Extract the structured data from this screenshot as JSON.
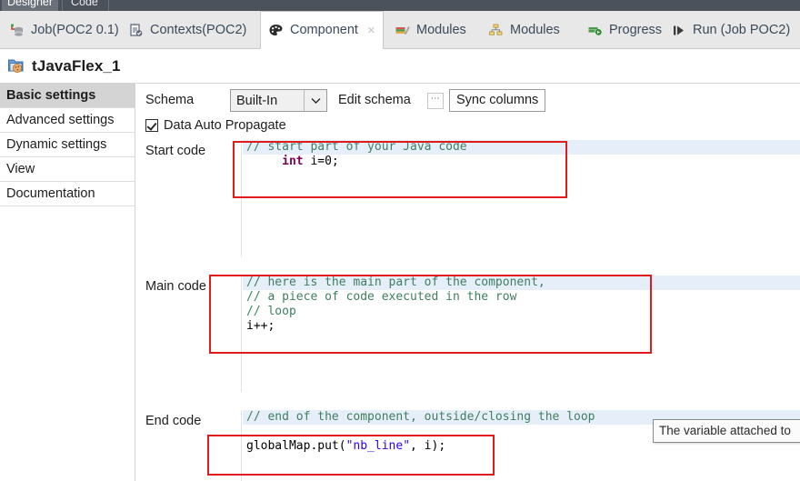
{
  "top_strip": {
    "tabs": [
      {
        "label": "Designer",
        "active": true
      },
      {
        "label": "Code",
        "active": false
      }
    ]
  },
  "tabbar": {
    "tabs": [
      {
        "label": "Job(POC2 0.1)",
        "icon": "job-icon",
        "active": false,
        "closable": false
      },
      {
        "label": "Contexts(POC2)",
        "icon": "contexts-icon",
        "active": false,
        "closable": false
      },
      {
        "label": "Component",
        "icon": "palette-icon",
        "active": true,
        "closable": true,
        "close_label": "×"
      },
      {
        "label": "Modules",
        "icon": "modules-books-icon",
        "active": false,
        "closable": false
      },
      {
        "label": "Modules",
        "icon": "modules-tree-icon",
        "active": false,
        "closable": false
      },
      {
        "label": "Progress",
        "icon": "progress-icon",
        "active": false,
        "closable": false
      },
      {
        "label": "Run (Job POC2)",
        "icon": "run-icon",
        "active": false,
        "closable": false
      }
    ]
  },
  "header": {
    "title": "tJavaFlex_1",
    "icon": "component-cookie-icon"
  },
  "sidebar": {
    "items": [
      {
        "label": "Basic settings",
        "selected": true
      },
      {
        "label": "Advanced settings",
        "selected": false
      },
      {
        "label": "Dynamic settings",
        "selected": false
      },
      {
        "label": "View",
        "selected": false
      },
      {
        "label": "Documentation",
        "selected": false
      }
    ]
  },
  "main": {
    "schema": {
      "label": "Schema",
      "value": "Built-In",
      "dropdown_arrow": "⌄",
      "edit_schema_label": "Edit schema",
      "ellipsis_button": "⋯",
      "sync_columns_label": "Sync columns"
    },
    "data_auto_propagate": {
      "label": "Data Auto Propagate",
      "checked": true
    },
    "start_code": {
      "label": "Start code",
      "lines": [
        {
          "highlight": true,
          "tokens": [
            {
              "t": "comment",
              "s": "// start part of your Java code"
            }
          ]
        },
        {
          "highlight": false,
          "tokens": [
            {
              "t": "plain",
              "s": "     "
            },
            {
              "t": "kw",
              "s": "int"
            },
            {
              "t": "plain",
              "s": " i=0;"
            }
          ]
        },
        {
          "highlight": false,
          "tokens": [
            {
              "t": "plain",
              "s": ""
            }
          ]
        },
        {
          "highlight": false,
          "tokens": [
            {
              "t": "plain",
              "s": ""
            }
          ]
        },
        {
          "highlight": false,
          "tokens": [
            {
              "t": "plain",
              "s": ""
            }
          ]
        },
        {
          "highlight": false,
          "tokens": [
            {
              "t": "plain",
              "s": ""
            }
          ]
        },
        {
          "highlight": false,
          "tokens": [
            {
              "t": "plain",
              "s": ""
            }
          ]
        },
        {
          "highlight": false,
          "tokens": [
            {
              "t": "plain",
              "s": ""
            }
          ]
        }
      ]
    },
    "main_code": {
      "label": "Main code",
      "lines": [
        {
          "highlight": true,
          "tokens": [
            {
              "t": "comment",
              "s": "// here is the main part of the component,"
            }
          ]
        },
        {
          "highlight": false,
          "tokens": [
            {
              "t": "comment",
              "s": "// a piece of code executed in the row"
            }
          ]
        },
        {
          "highlight": false,
          "tokens": [
            {
              "t": "comment",
              "s": "// loop"
            }
          ]
        },
        {
          "highlight": false,
          "tokens": [
            {
              "t": "plain",
              "s": "i++;"
            }
          ]
        },
        {
          "highlight": false,
          "tokens": [
            {
              "t": "plain",
              "s": ""
            }
          ]
        },
        {
          "highlight": false,
          "tokens": [
            {
              "t": "plain",
              "s": ""
            }
          ]
        },
        {
          "highlight": false,
          "tokens": [
            {
              "t": "plain",
              "s": ""
            }
          ]
        },
        {
          "highlight": false,
          "tokens": [
            {
              "t": "plain",
              "s": ""
            }
          ]
        }
      ]
    },
    "end_code": {
      "label": "End code",
      "lines": [
        {
          "highlight": true,
          "tokens": [
            {
              "t": "comment",
              "s": "// end of the component, outside/closing the loop"
            }
          ]
        },
        {
          "highlight": false,
          "tokens": [
            {
              "t": "plain",
              "s": ""
            }
          ]
        },
        {
          "highlight": false,
          "tokens": [
            {
              "t": "plain",
              "s": "globalMap.put("
            },
            {
              "t": "str",
              "s": "\"nb_line\""
            },
            {
              "t": "plain",
              "s": ", i);"
            }
          ]
        },
        {
          "highlight": false,
          "tokens": [
            {
              "t": "plain",
              "s": ""
            }
          ]
        },
        {
          "highlight": false,
          "tokens": [
            {
              "t": "plain",
              "s": ""
            }
          ]
        }
      ]
    }
  },
  "tooltip": {
    "text": "The variable attached to"
  },
  "colors": {
    "annotation_red": "#e01b1b",
    "highlight_line": "#e6eefa",
    "comment_green": "#3f7f5f",
    "keyword_purple": "#7f0055",
    "string_blue": "#2a00ff",
    "selected_nav": "#d4d4d4",
    "tabbar_bg": "#e8e8e8",
    "top_strip_bg": "#4c525c"
  }
}
